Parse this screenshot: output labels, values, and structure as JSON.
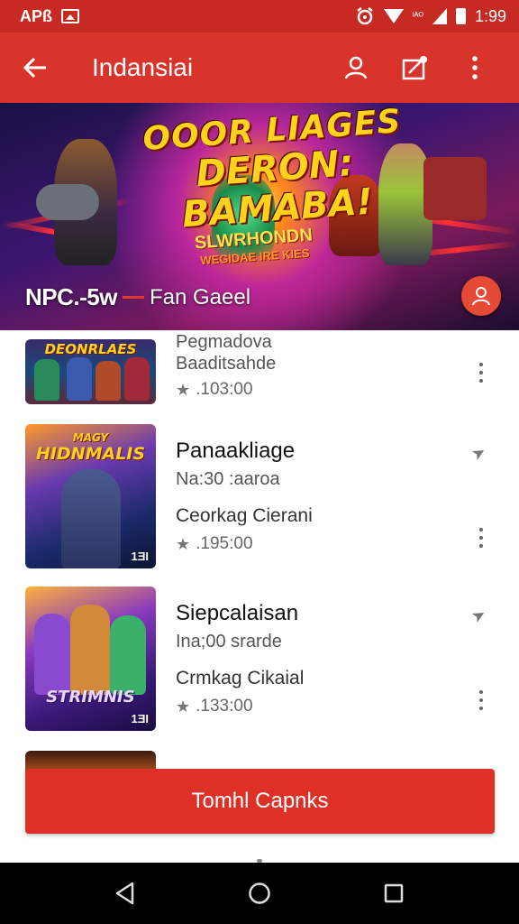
{
  "status_bar": {
    "carrier": "APß",
    "small_label": "ᴵᴬᴼ",
    "time": "1:99",
    "icons": [
      "image-icon",
      "alarm-icon",
      "wifi-icon",
      "signal-icon",
      "battery-icon"
    ]
  },
  "app_bar": {
    "title": "Indansiai",
    "back_icon": "arrow-left-icon",
    "actions": [
      "account-icon",
      "share-edit-icon",
      "more-vert-icon"
    ],
    "color": "#d9342b"
  },
  "banner": {
    "logo_line1": "OOOR LIAGES",
    "logo_line2": "DERON: BAMABA!",
    "sub_line1": "SLWRHONDN",
    "sub_line2": "WEGIDAE IRE KIES",
    "caption_main": "NPC.-5w",
    "caption_sub": "Fan Gaeel",
    "fab_icon": "person-icon"
  },
  "items": [
    {
      "title": "",
      "subtitle": "Pegmadova",
      "description": "Baaditsahde",
      "rating": ".103:00",
      "thumb_text": "DEONRLAES",
      "badge": "",
      "has_share": false
    },
    {
      "title": "Panaakliage",
      "subtitle": "Na:30 :aaroa",
      "description": "Ceorkag Cierani",
      "rating": ".195:00",
      "thumb_text": "HIDNMALIS",
      "thumb_top": "MAGY",
      "badge": "1ƎI",
      "has_share": true
    },
    {
      "title": "Siepcalaisan",
      "subtitle": "Ina;00 srarde",
      "description": "Crmkag Cikaial",
      "rating": ".133:00",
      "thumb_text": "STRIMNIS",
      "badge": "1ƎI",
      "has_share": true
    }
  ],
  "cta_button": {
    "label": "Tomhl Capnks",
    "color": "#dd3128"
  },
  "nav_bar": {
    "buttons": [
      "back-triangle-icon",
      "home-circle-icon",
      "recents-square-icon"
    ]
  }
}
